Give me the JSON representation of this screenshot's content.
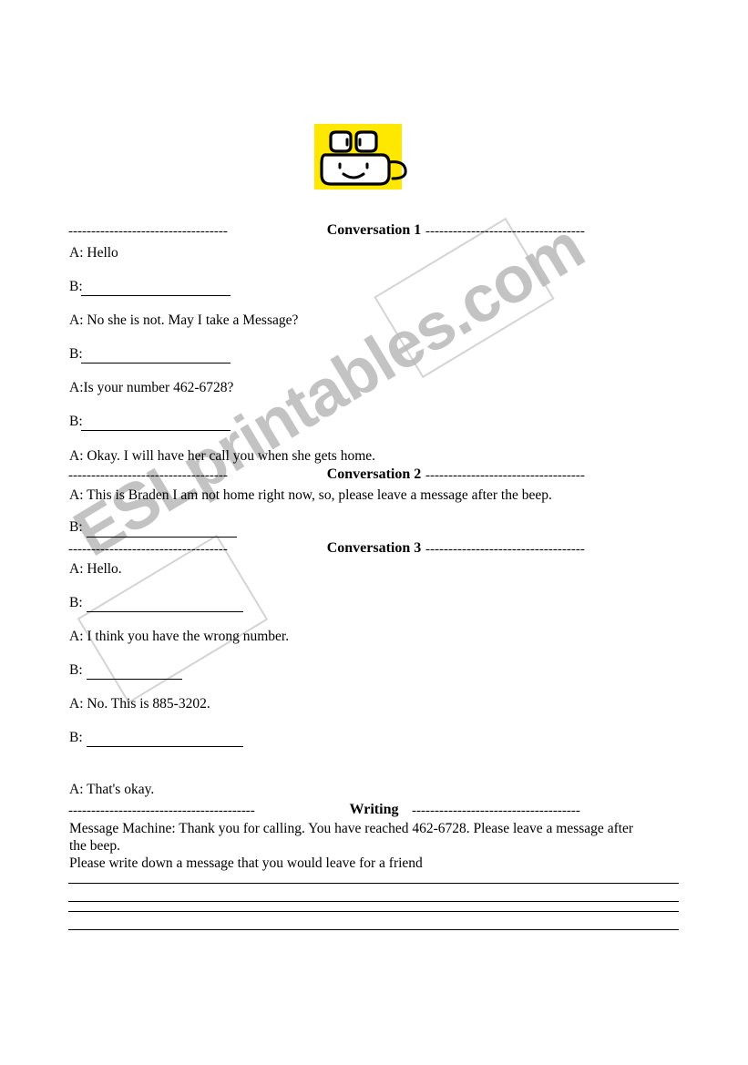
{
  "document": {
    "watermark": "ESLprintables.com",
    "icon_name": "telephone-icon",
    "sections": [
      {
        "heading": "Conversation 1",
        "dash_left": "-----------------------------------",
        "dash_right": "-----------------------------------"
      },
      {
        "heading": "Conversation 2",
        "dash_left": "-----------------------------------",
        "dash_right": "-----------------------------------"
      },
      {
        "heading": "Conversation 3",
        "dash_left": "-----------------------------------",
        "dash_right": "-----------------------------------"
      },
      {
        "heading": "Writing",
        "dash_left": "-----------------------------------------",
        "dash_right": "-------------------------------------"
      }
    ],
    "conversation1": {
      "line1": "A: Hello",
      "b1": "B:",
      "line2": "A: No she is not.    May I take a Message?",
      "b2": "B:",
      "line3": "A:Is your number 462-6728?",
      "b3": "B:",
      "line4": "A: Okay.    I will have her call you when she gets home."
    },
    "conversation2": {
      "line1": "A:    This is Braden I am not home right now, so,    please leave a message after   the beep.",
      "b1": "B:"
    },
    "conversation3": {
      "line1": "A: Hello.",
      "b1": "B:",
      "line2": "A: I think you have the wrong number.",
      "b2": "B:",
      "line3": "A: No.    This is 885-3202.",
      "b3": "B:",
      "line4": "A: That's okay."
    },
    "writing": {
      "line1": "Message Machine: Thank you for calling.      You have reached 462-6728. Please leave a message after",
      "line2": "the beep.",
      "line3": "Please write down a message that you would leave for a friend"
    },
    "colors": {
      "icon_background": "#ffe800",
      "text": "#000000",
      "watermark": "#b9b9b9"
    }
  }
}
